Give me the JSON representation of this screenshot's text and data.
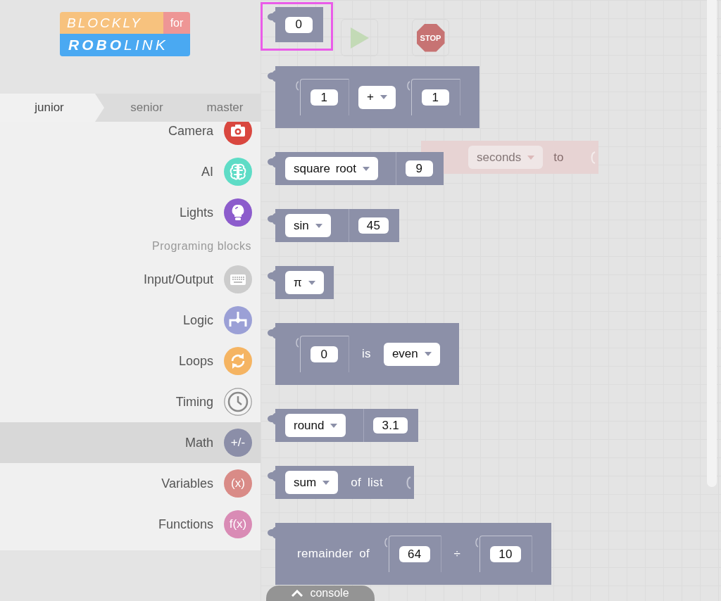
{
  "logo": {
    "top": "BLOCKLY",
    "tag": "for",
    "bottom": "**ROBO**LINK"
  },
  "tabs": [
    {
      "label": "junior",
      "selected": true
    },
    {
      "label": "senior",
      "selected": false
    },
    {
      "label": "master",
      "selected": false
    }
  ],
  "categories": [
    {
      "kind": "category",
      "label": "Camera",
      "color": "#d9473f",
      "selected": false
    },
    {
      "kind": "category",
      "label": "AI",
      "color": "#5edcc6",
      "selected": false
    },
    {
      "kind": "category",
      "label": "Lights",
      "color": "#8c5ccc",
      "selected": false
    },
    {
      "kind": "heading",
      "label": "Programing blocks"
    },
    {
      "kind": "category",
      "label": "Input/Output",
      "color": "#cccccc",
      "selected": false
    },
    {
      "kind": "category",
      "label": "Logic",
      "color": "#9ba0d6",
      "selected": false
    },
    {
      "kind": "category",
      "label": "Loops",
      "color": "#f5b462",
      "selected": false
    },
    {
      "kind": "category",
      "label": "Timing",
      "color": "#f4f4f4",
      "selected": false
    },
    {
      "kind": "category",
      "label": "Math",
      "symbol": "+/-",
      "color": "#8b8ea8",
      "selected": true
    },
    {
      "kind": "category",
      "label": "Variables",
      "symbol": "(x)",
      "color": "#d98b87",
      "selected": false
    },
    {
      "kind": "category",
      "label": "Functions",
      "symbol": "f(x)",
      "color": "#d98bb5",
      "selected": false
    }
  ],
  "workspace": {
    "stop_label": "STOP",
    "block": {
      "parts": [
        {
          "kind": "dropdown",
          "value": "seconds"
        },
        {
          "kind": "text",
          "value": "to"
        }
      ]
    }
  },
  "flyout": {
    "blocks": [
      {
        "kind": "value",
        "selected": true,
        "parts": [
          {
            "kind": "number",
            "value": "0"
          }
        ]
      },
      {
        "kind": "tall",
        "selected": false,
        "parts": [
          {
            "kind": "socket",
            "value": "1"
          },
          {
            "kind": "dropdown",
            "value": "+"
          },
          {
            "kind": "socket",
            "value": "1"
          }
        ]
      },
      {
        "kind": "inline",
        "selected": false,
        "parts": [
          {
            "kind": "dropdown",
            "value": "square root"
          },
          {
            "kind": "plug",
            "value": "9"
          }
        ]
      },
      {
        "kind": "inline",
        "selected": false,
        "parts": [
          {
            "kind": "dropdown",
            "value": "sin"
          },
          {
            "kind": "plug",
            "value": "45"
          }
        ]
      },
      {
        "kind": "inline",
        "selected": false,
        "parts": [
          {
            "kind": "dropdown",
            "value": "π"
          }
        ]
      },
      {
        "kind": "tall",
        "selected": false,
        "parts": [
          {
            "kind": "socket",
            "value": "0"
          },
          {
            "kind": "text",
            "value": "is"
          },
          {
            "kind": "dropdown",
            "value": "even"
          }
        ]
      },
      {
        "kind": "inline",
        "selected": false,
        "parts": [
          {
            "kind": "dropdown",
            "value": "round"
          },
          {
            "kind": "plug",
            "value": "3.1"
          }
        ]
      },
      {
        "kind": "inline",
        "selected": false,
        "parts": [
          {
            "kind": "dropdown",
            "value": "sum"
          },
          {
            "kind": "text",
            "value": "of list"
          },
          {
            "kind": "slot"
          }
        ]
      },
      {
        "kind": "tall",
        "selected": false,
        "parts": [
          {
            "kind": "text",
            "value": "remainder of"
          },
          {
            "kind": "socket",
            "value": "64"
          },
          {
            "kind": "text",
            "value": "÷"
          },
          {
            "kind": "socket",
            "value": "10"
          }
        ]
      }
    ]
  },
  "console": {
    "label": "console"
  }
}
